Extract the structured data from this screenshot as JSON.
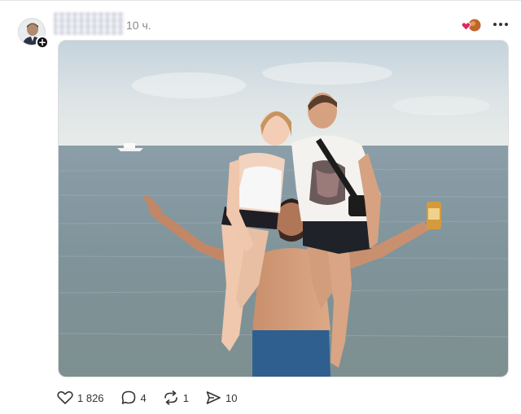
{
  "post": {
    "timestamp": "10 ч.",
    "avatar_icon": "avatar-with-plus-icon",
    "reaction_icon": "reaction-heart-badge-icon",
    "more_icon": "ellipsis-icon"
  },
  "actions": {
    "likes": "1 826",
    "comments": "4",
    "reposts": "1",
    "shares": "10"
  },
  "colors": {
    "heart_red": "#e0245e",
    "text_muted": "#8a8a8a"
  }
}
